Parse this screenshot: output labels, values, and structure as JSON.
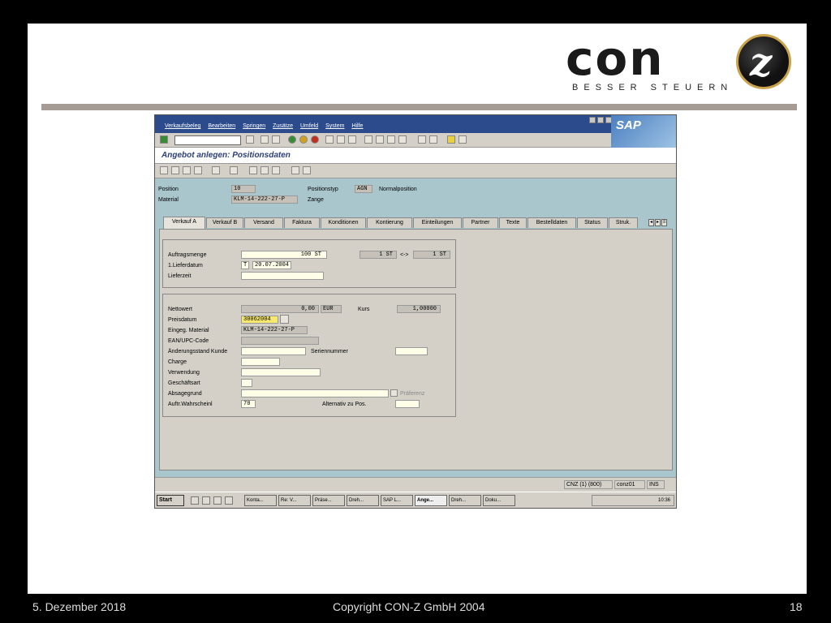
{
  "slide": {
    "logo_text": "con",
    "logo_mark": "z",
    "tagline": "BESSER STEUERN"
  },
  "footer": {
    "date": "5. Dezember 2018",
    "copyright": "Copyright CON-Z GmbH 2004",
    "page": "18"
  },
  "sap": {
    "menu": [
      "Verkaufsbeleg",
      "Bearbeiten",
      "Springen",
      "Zusätze",
      "Umfeld",
      "System",
      "Hilfe"
    ],
    "brand": "SAP",
    "title": "Angebot anlegen: Positionsdaten",
    "header": {
      "position_label": "Position",
      "position_value": "10",
      "positionstyp_label": "Positionstyp",
      "positionstyp_value": "AGN",
      "positionstyp_text": "Normalposition",
      "material_label": "Material",
      "material_value": "KLM-14-222-27-P",
      "material_text": "Zange"
    },
    "tabs": [
      "Verkauf A",
      "Verkauf B",
      "Versand",
      "Faktura",
      "Konditionen",
      "Kontierung",
      "Einteilungen",
      "Partner",
      "Texte",
      "Bestelldaten",
      "Status",
      "Struk."
    ],
    "group1": {
      "auftragsmenge_label": "Auftragsmenge",
      "auftragsmenge_value": "100 ST",
      "conv_left": "1 ST",
      "conv_arrow": "<->",
      "conv_right": "1 ST",
      "lieferdatum_label": "1.Lieferdatum",
      "lieferdatum_type": "T",
      "lieferdatum_value": "20.07.2004",
      "lieferzeit_label": "Lieferzeit"
    },
    "group2": {
      "nettowert_label": "Nettowert",
      "nettowert_value": "0,00",
      "currency": "EUR",
      "kurs_label": "Kurs",
      "kurs_value": "1,00000",
      "preisdatum_label": "Preisdatum",
      "preisdatum_value": "30062004",
      "eingeg_material_label": "Eingeg. Material",
      "eingeg_material_value": "KLM-14-222-27-P",
      "ean_label": "EAN/UPC-Code",
      "aenderungsstand_label": "Änderungsstand Kunde",
      "seriennummer_label": "Seriennummer",
      "charge_label": "Charge",
      "verwendung_label": "Verwendung",
      "geschaeftsart_label": "Geschäftsart",
      "absagegrund_label": "Absagegrund",
      "praeferenz_label": "Präferenz",
      "wahrscheinl_label": "Auftr.Wahrscheinl",
      "wahrscheinl_value": "70",
      "alternativ_label": "Alternativ zu Pos."
    },
    "status": {
      "system": "CNZ (1) (800)",
      "user": "conz01",
      "mode": "INS"
    },
    "taskbar": {
      "start": "Start",
      "tasks": [
        "Konta...",
        "Re: V...",
        "Präse...",
        "Dreh...",
        "SAP L...",
        "Ange...",
        "Dreh...",
        "Doku..."
      ],
      "clock": "10:36"
    }
  }
}
